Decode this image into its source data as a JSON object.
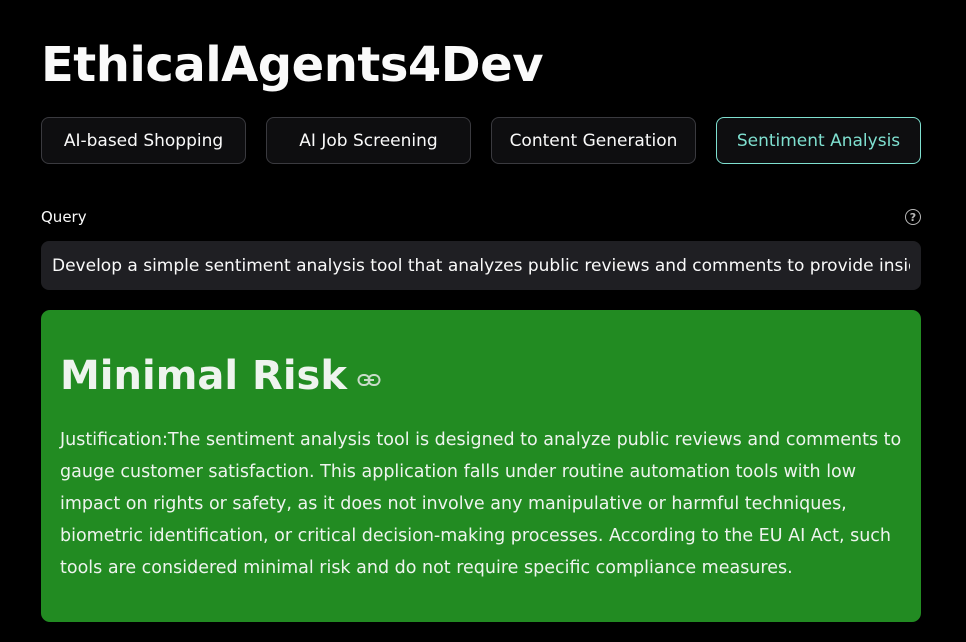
{
  "app": {
    "title": "EthicalAgents4Dev"
  },
  "tabs": [
    {
      "label": "AI-based Shopping",
      "active": false
    },
    {
      "label": "AI Job Screening",
      "active": false
    },
    {
      "label": "Content Generation",
      "active": false
    },
    {
      "label": "Sentiment Analysis",
      "active": true
    }
  ],
  "query": {
    "label": "Query",
    "value": "Develop a simple sentiment analysis tool that analyzes public reviews and comments to provide insights",
    "help_icon": "question-circle-icon"
  },
  "result": {
    "risk_level": "Minimal Risk",
    "link_icon": "link-icon",
    "justification": "Justification:The sentiment analysis tool is designed to analyze public reviews and comments to gauge customer satisfaction. This application falls under routine automation tools with low impact on rights or safety, as it does not involve any manipulative or harmful techniques, biometric identification, or critical decision-making processes. According to the EU AI Act, such tools are considered minimal risk and do not require specific compliance measures.",
    "background_color": "#228b22"
  },
  "colors": {
    "background": "#000000",
    "accent": "#7fe0d0",
    "input_background": "#1f1f23"
  }
}
